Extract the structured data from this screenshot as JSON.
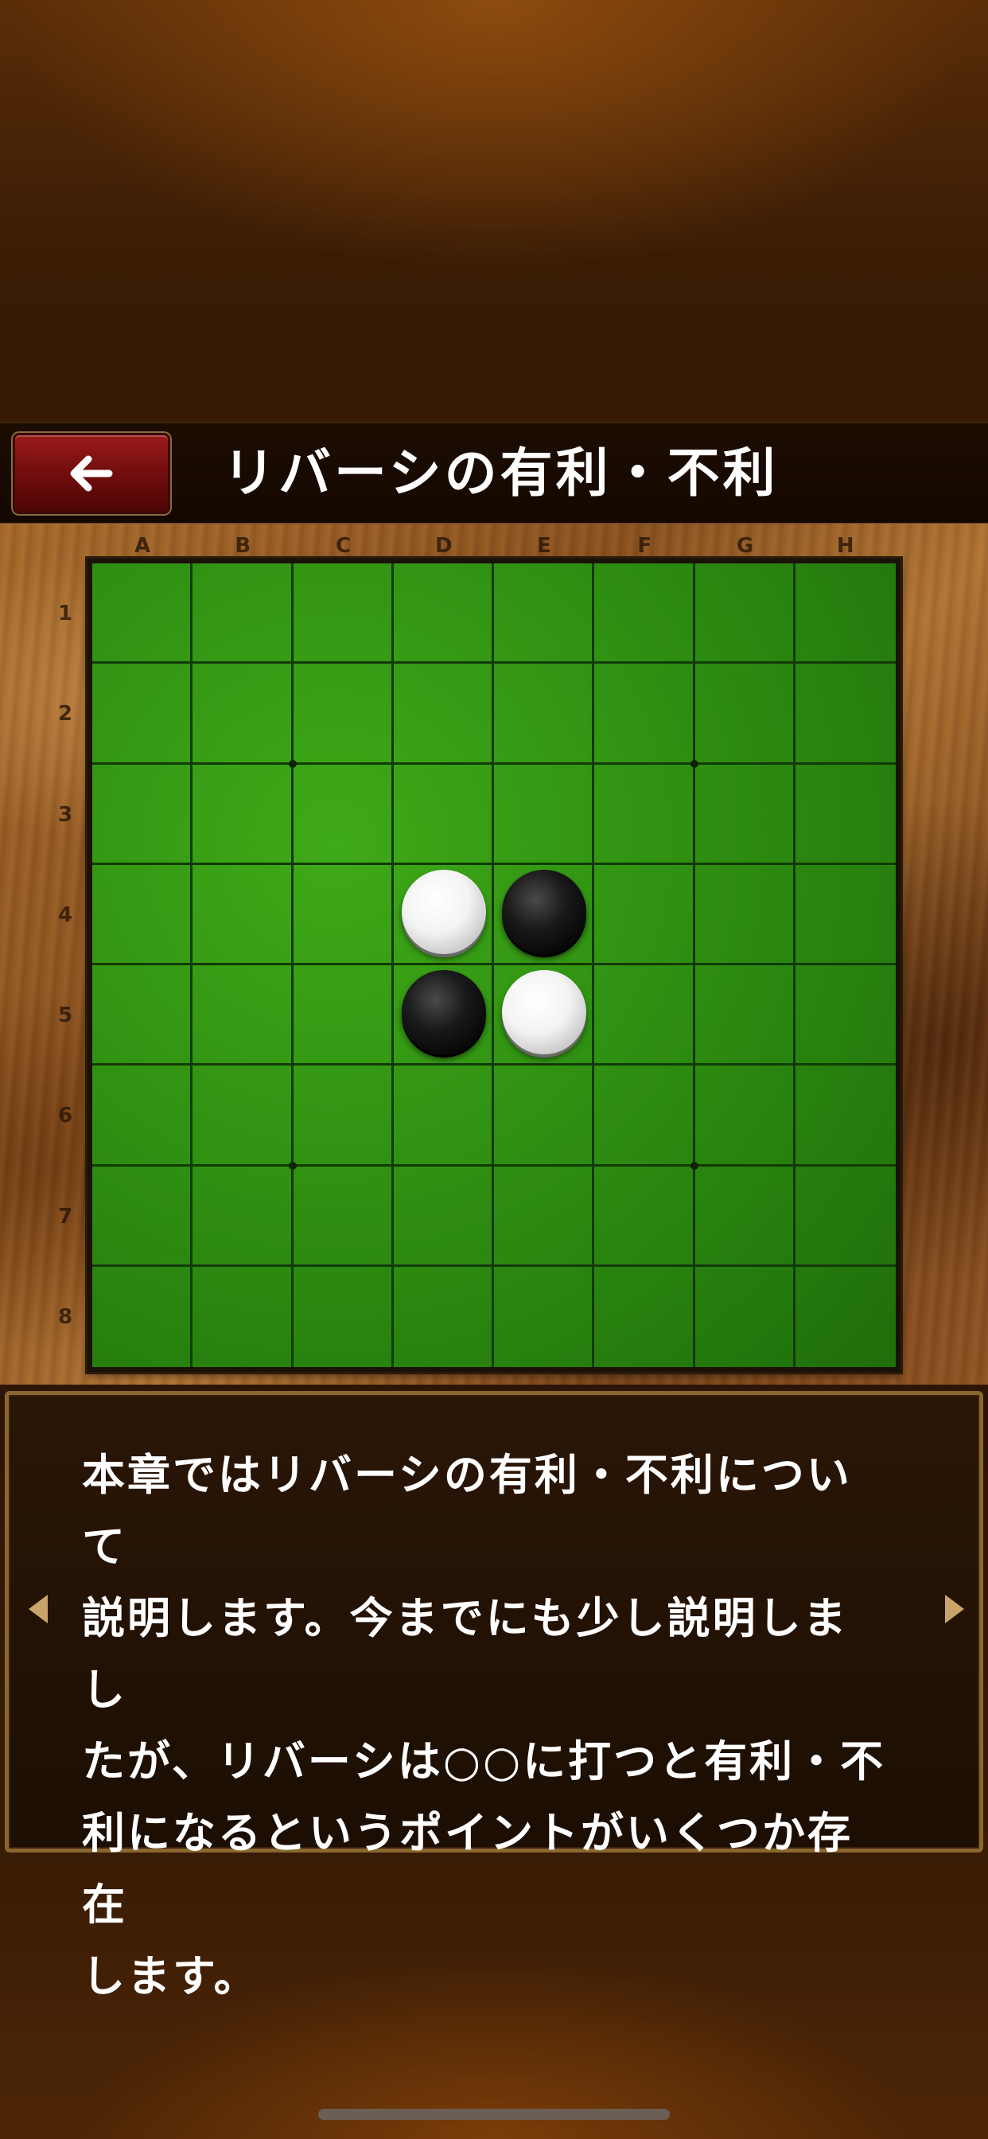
{
  "header": {
    "title": "リバーシの有利・不利",
    "back_icon": "arrow-left-icon"
  },
  "board": {
    "columns": [
      "A",
      "B",
      "C",
      "D",
      "E",
      "F",
      "G",
      "H"
    ],
    "rows": [
      "1",
      "2",
      "3",
      "4",
      "5",
      "6",
      "7",
      "8"
    ],
    "stones": [
      {
        "cell": "D4",
        "color": "white"
      },
      {
        "cell": "E4",
        "color": "black"
      },
      {
        "cell": "D5",
        "color": "black"
      },
      {
        "cell": "E5",
        "color": "white"
      }
    ]
  },
  "panel": {
    "message": "本章ではリバーシの有利・不利について\n説明します。今までにも少し説明しまし\nたが、リバーシは○○に打つと有利・不\n利になるというポイントがいくつか存在\nします。",
    "prev_icon": "triangle-left-icon",
    "next_icon": "triangle-right-icon"
  },
  "colors": {
    "board_green": "#2f9012",
    "header_bg": "#140801",
    "back_button_red": "#8a1212",
    "panel_border": "#8a6630",
    "arrow_gold": "#c8a46a"
  }
}
